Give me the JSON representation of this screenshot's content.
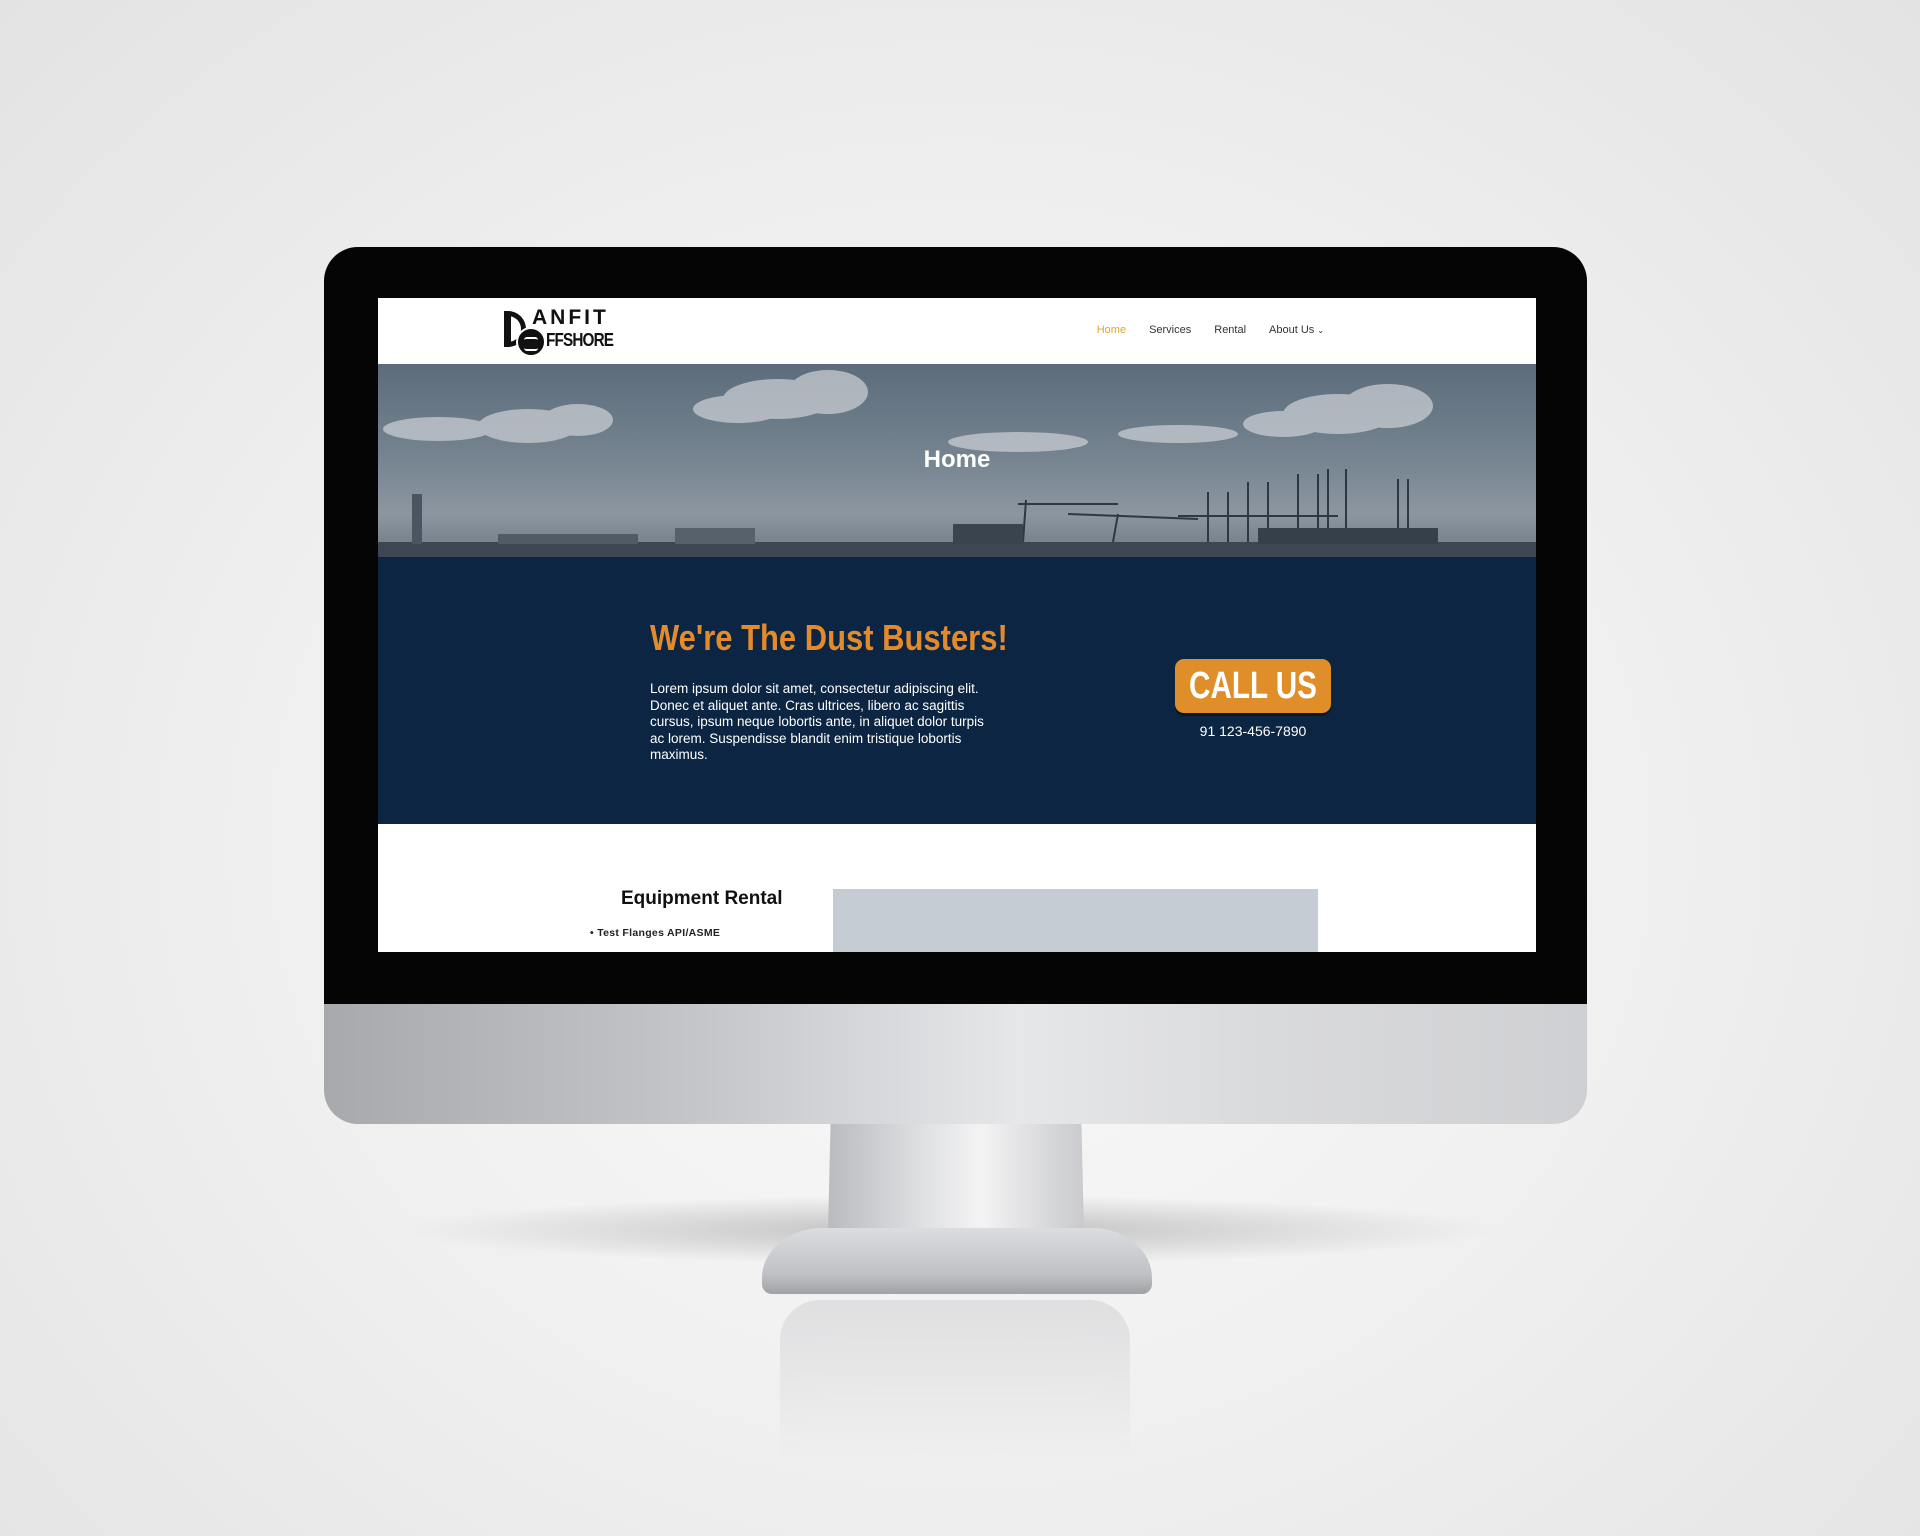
{
  "logo": {
    "line1": "ANFIT",
    "line2": "FFSHORE"
  },
  "nav": {
    "items": [
      {
        "label": "Home",
        "active": true
      },
      {
        "label": "Services",
        "active": false
      },
      {
        "label": "Rental",
        "active": false
      },
      {
        "label": "About Us",
        "active": false
      }
    ],
    "accent_color": "#e2a233"
  },
  "hero": {
    "title": "Home"
  },
  "cta": {
    "heading": "We're The Dust Busters!",
    "body": "Lorem ipsum dolor sit amet, consectetur adipiscing elit. Donec et aliquet ante. Cras ultrices, libero ac sagittis cursus, ipsum neque lobortis ante, in aliquet dolor turpis ac lorem. Suspendisse blandit enim tristique lobortis maximus.",
    "button_label": "CALL US",
    "phone": "91 123-456-7890",
    "background_color": "#0c2542",
    "heading_color": "#e38b2c"
  },
  "rental": {
    "title": "Equipment Rental",
    "items": [
      "Test Flanges API/ASME"
    ]
  }
}
